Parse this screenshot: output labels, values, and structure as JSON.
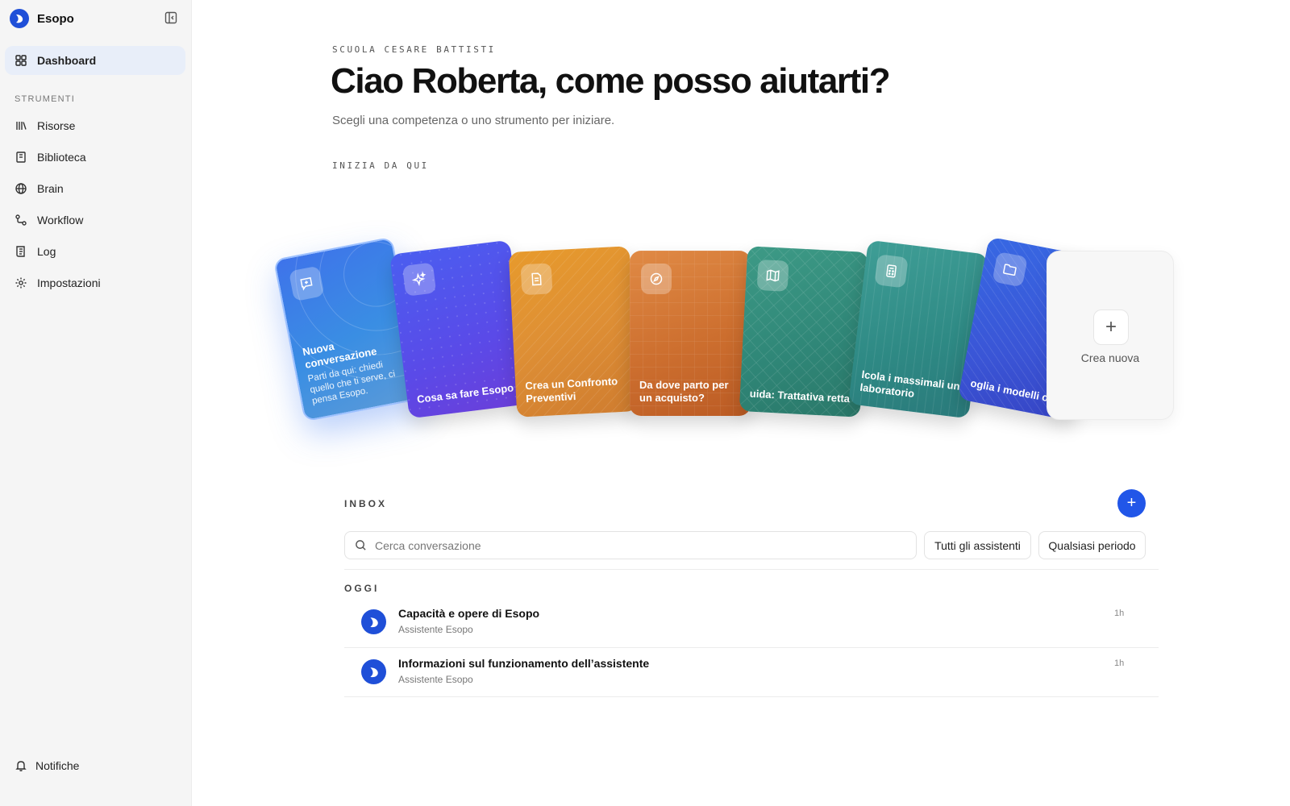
{
  "app": {
    "name": "Esopo"
  },
  "sidebar": {
    "active_item": "Dashboard",
    "section_label": "STRUMENTI",
    "items": [
      {
        "label": "Risorse",
        "icon": "library-icon"
      },
      {
        "label": "Biblioteca",
        "icon": "book-icon"
      },
      {
        "label": "Brain",
        "icon": "globe-icon"
      },
      {
        "label": "Workflow",
        "icon": "workflow-icon"
      },
      {
        "label": "Log",
        "icon": "log-icon"
      },
      {
        "label": "Impostazioni",
        "icon": "gear-icon"
      }
    ],
    "notifications_label": "Notifiche"
  },
  "header": {
    "school": "SCUOLA CESARE BATTISTI",
    "greeting": "Ciao Roberta, come posso aiutarti?",
    "subtitle": "Scegli una competenza o uno strumento per iniziare.",
    "start_label": "INIZIA DA QUI"
  },
  "cards": [
    {
      "title": "Nuova conversazione",
      "description": "Parti da qui: chiedi quello che ti serve, ci pensa Esopo.",
      "icon": "chat-plus-icon"
    },
    {
      "title": "Cosa sa fare Esopo",
      "icon": "sparkle-icon"
    },
    {
      "title": "Crea un Confronto Preventivi",
      "icon": "document-icon"
    },
    {
      "title": "Da dove parto per un acquisto?",
      "icon": "compass-icon"
    },
    {
      "title": "uida: Trattativa retta",
      "icon": "map-icon"
    },
    {
      "title": "lcola i massimali un laboratorio",
      "icon": "calculator-icon"
    },
    {
      "title": "oglia i modelli onti",
      "icon": "folder-icon"
    }
  ],
  "create_card": {
    "label": "Crea nuova",
    "plus": "+"
  },
  "inbox": {
    "label": "INBOX",
    "add_button": "+",
    "search_placeholder": "Cerca conversazione",
    "filter_assistants": "Tutti gli assistenti",
    "filter_period": "Qualsiasi periodo",
    "group_label": "OGGI",
    "conversations": [
      {
        "title": "Capacità e opere di Esopo",
        "assistant": "Assistente Esopo",
        "time": "1h"
      },
      {
        "title": "Informazioni sul funzionamento dell’assistente",
        "assistant": "Assistente Esopo",
        "time": "1h"
      }
    ]
  },
  "colors": {
    "accent": "#2156e8",
    "brand": "#1f4fd8",
    "sidebar_bg": "#f5f5f5"
  }
}
